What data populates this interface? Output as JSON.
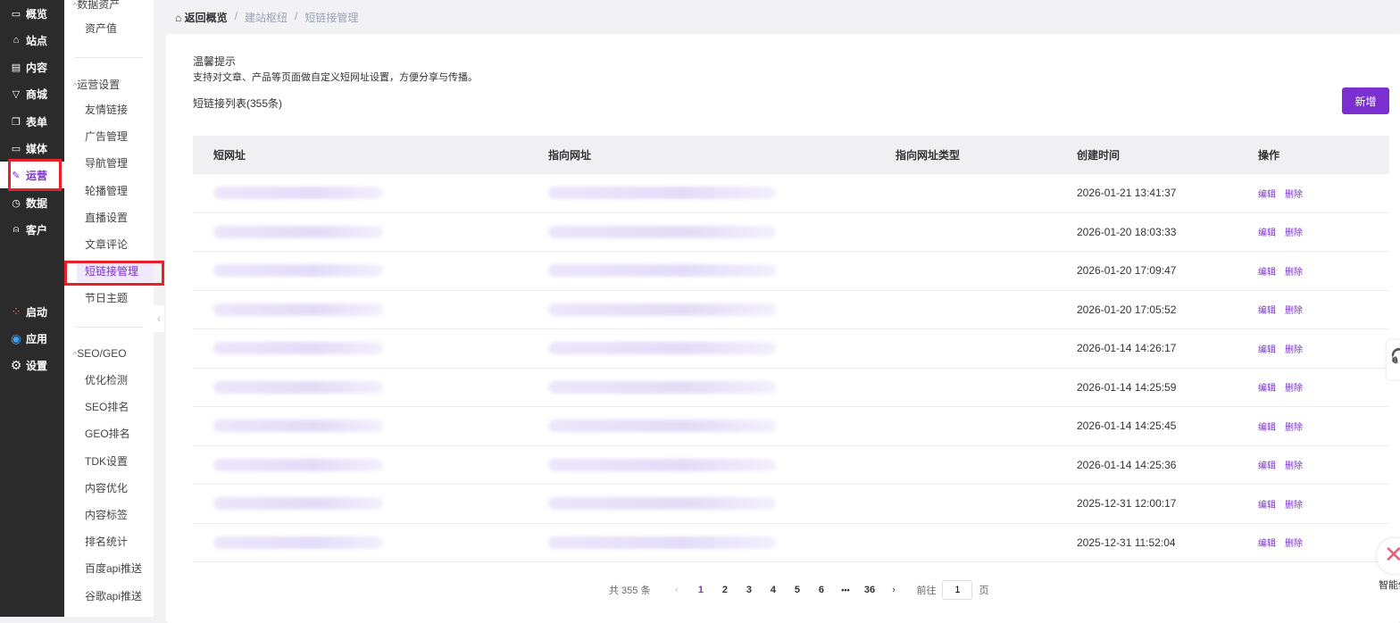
{
  "nav": {
    "items": [
      {
        "label": "概览",
        "icon": "monitor-icon",
        "glyph": "▭"
      },
      {
        "label": "站点",
        "icon": "home-icon",
        "glyph": "⌂"
      },
      {
        "label": "内容",
        "icon": "document-icon",
        "glyph": "▤"
      },
      {
        "label": "商城",
        "icon": "cart-icon",
        "glyph": "▽"
      },
      {
        "label": "表单",
        "icon": "form-icon",
        "glyph": "❐"
      },
      {
        "label": "媒体",
        "icon": "video-icon",
        "glyph": "▭"
      },
      {
        "label": "运营",
        "icon": "paperclip-icon",
        "glyph": "✎"
      },
      {
        "label": "数据",
        "icon": "clock-icon",
        "glyph": "◷"
      },
      {
        "label": "客户",
        "icon": "user-icon",
        "glyph": "⍝"
      }
    ],
    "bottom": [
      {
        "label": "启动",
        "icon": "launch-icon",
        "glyph": "⁘"
      },
      {
        "label": "应用",
        "icon": "apps-icon",
        "glyph": "◉"
      },
      {
        "label": "设置",
        "icon": "gear-icon",
        "glyph": "⚙"
      }
    ]
  },
  "submenu": {
    "group1": {
      "title": "数据资产",
      "items": [
        "资产值"
      ]
    },
    "group2": {
      "title": "运营设置",
      "items": [
        "友情链接",
        "广告管理",
        "导航管理",
        "轮播管理",
        "直播设置",
        "文章评论",
        "短链接管理",
        "节日主题"
      ]
    },
    "group3": {
      "title": "SEO/GEO",
      "items": [
        "优化检测",
        "SEO排名",
        "GEO排名",
        "TDK设置",
        "内容优化",
        "内容标签",
        "排名统计",
        "百度api推送",
        "谷歌api推送"
      ]
    }
  },
  "breadcrumb": [
    "返回概览",
    "建站枢纽",
    "短链接管理"
  ],
  "tip": {
    "title": "温馨提示",
    "desc": "支持对文章、产品等页面做自定义短网址设置，方便分享与传播。"
  },
  "list_title": "短链接列表(355条)",
  "add_button": "新增",
  "accent": "#7b2fd1",
  "table": {
    "headers": [
      "短网址",
      "指向网址",
      "指向网址类型",
      "创建时间",
      "操作"
    ],
    "rows": [
      {
        "created": "2026-01-21 13:41:37"
      },
      {
        "created": "2026-01-20 18:03:33"
      },
      {
        "created": "2026-01-20 17:09:47"
      },
      {
        "created": "2026-01-20 17:05:52"
      },
      {
        "created": "2026-01-14 14:26:17"
      },
      {
        "created": "2026-01-14 14:25:59"
      },
      {
        "created": "2026-01-14 14:25:45"
      },
      {
        "created": "2026-01-14 14:25:36"
      },
      {
        "created": "2025-12-31 12:00:17"
      },
      {
        "created": "2025-12-31 11:52:04"
      }
    ],
    "actions": {
      "edit": "编辑",
      "delete": "删除"
    }
  },
  "pagination": {
    "total": "共 355 条",
    "pages": [
      "1",
      "2",
      "3",
      "4",
      "5",
      "6"
    ],
    "ellipsis": "•••",
    "last": "36",
    "current": "1",
    "goto_prefix": "前往",
    "goto_value": "1",
    "goto_suffix": "页"
  },
  "ai_label": "智能体"
}
